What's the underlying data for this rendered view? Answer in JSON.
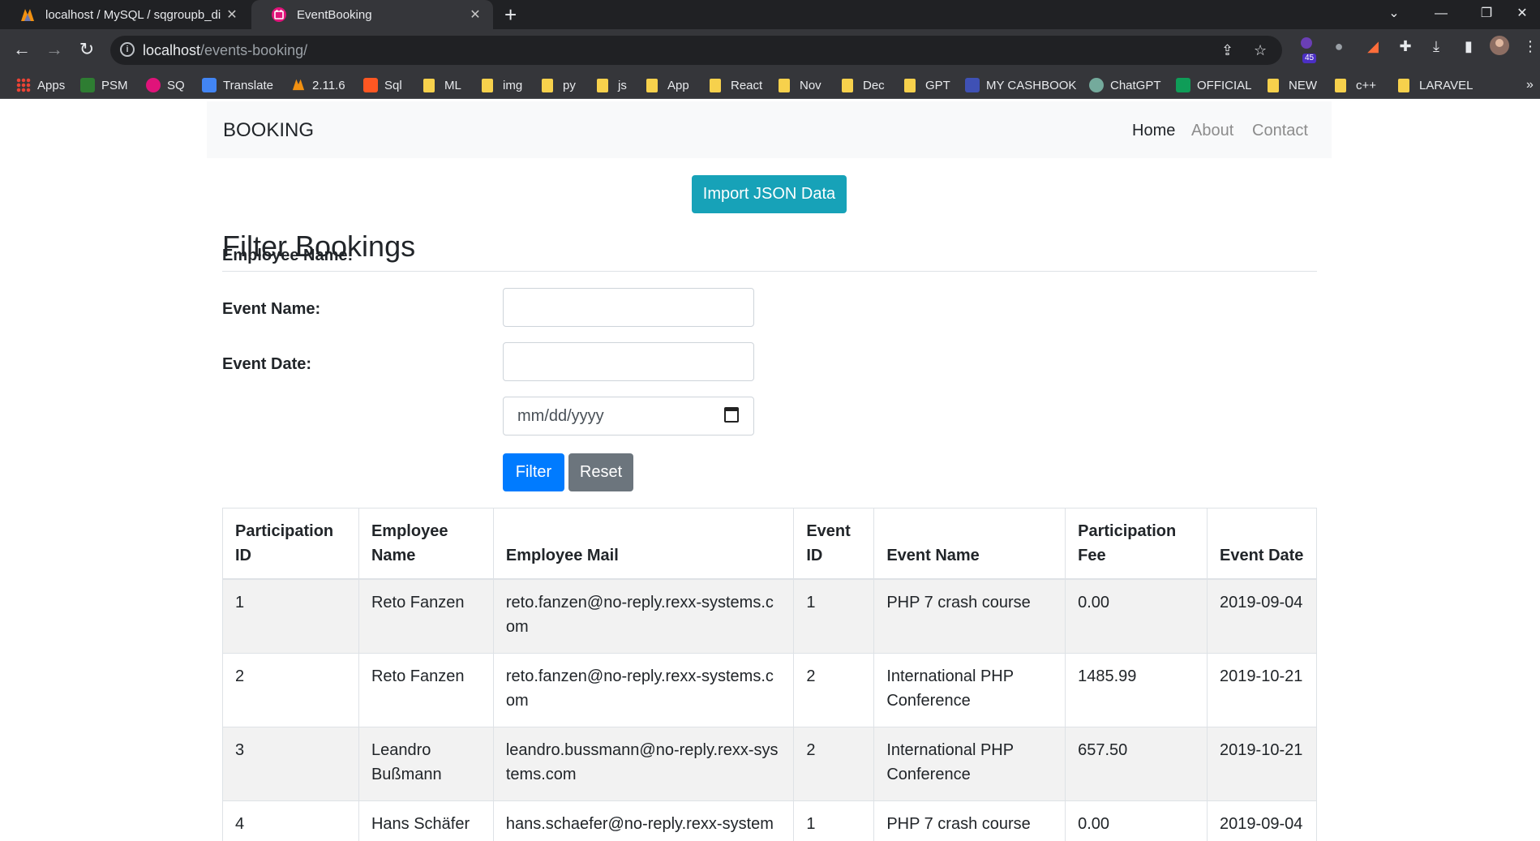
{
  "browser": {
    "tabs": [
      {
        "title": "localhost / MySQL / sqgroupb_di",
        "active": false
      },
      {
        "title": "EventBooking",
        "active": true
      }
    ],
    "url_host": "localhost",
    "url_path": "/events-booking/",
    "extension_badge": "45",
    "bookmarks": [
      "Apps",
      "PSM",
      "SQ",
      "Translate",
      "2.11.6",
      "Sql",
      "ML",
      "img",
      "py",
      "js",
      "App",
      "React",
      "Nov",
      "Dec",
      "GPT",
      "MY CASHBOOK",
      "ChatGPT",
      "OFFICIAL",
      "NEW",
      "c++",
      "LARAVEL"
    ]
  },
  "navbar": {
    "brand": "BOOKING",
    "links": [
      "Home",
      "About",
      "Contact"
    ]
  },
  "import_button": "Import JSON Data",
  "filter": {
    "heading": "Filter Bookings",
    "employee_label": "Employee Name:",
    "event_label": "Event Name:",
    "date_label": "Event Date:",
    "employee_value": "",
    "event_value": "",
    "date_placeholder": "mm/dd/yyyy",
    "filter_button": "Filter",
    "reset_button": "Reset"
  },
  "table": {
    "headers": [
      "Participation ID",
      "Employee Name",
      "Employee Mail",
      "Event ID",
      "Event Name",
      "Participation Fee",
      "Event Date"
    ],
    "rows": [
      [
        "1",
        "Reto Fanzen",
        "reto.fanzen@no-reply.rexx-systems.com",
        "1",
        "PHP 7 crash course",
        "0.00",
        "2019-09-04"
      ],
      [
        "2",
        "Reto Fanzen",
        "reto.fanzen@no-reply.rexx-systems.com",
        "2",
        "International PHP Conference",
        "1485.99",
        "2019-10-21"
      ],
      [
        "3",
        "Leandro Bußmann",
        "leandro.bussmann@no-reply.rexx-systems.com",
        "2",
        "International PHP Conference",
        "657.50",
        "2019-10-21"
      ],
      [
        "4",
        "Hans Schäfer",
        "hans.schaefer@no-reply.rexx-systems.com",
        "1",
        "PHP 7 crash course",
        "0.00",
        "2019-09-04"
      ]
    ]
  },
  "colors": {
    "import_button": "#17a2b8",
    "filter_button": "#007bff",
    "reset_button": "#6c757d",
    "navbar_bg": "#f8f9fa"
  }
}
